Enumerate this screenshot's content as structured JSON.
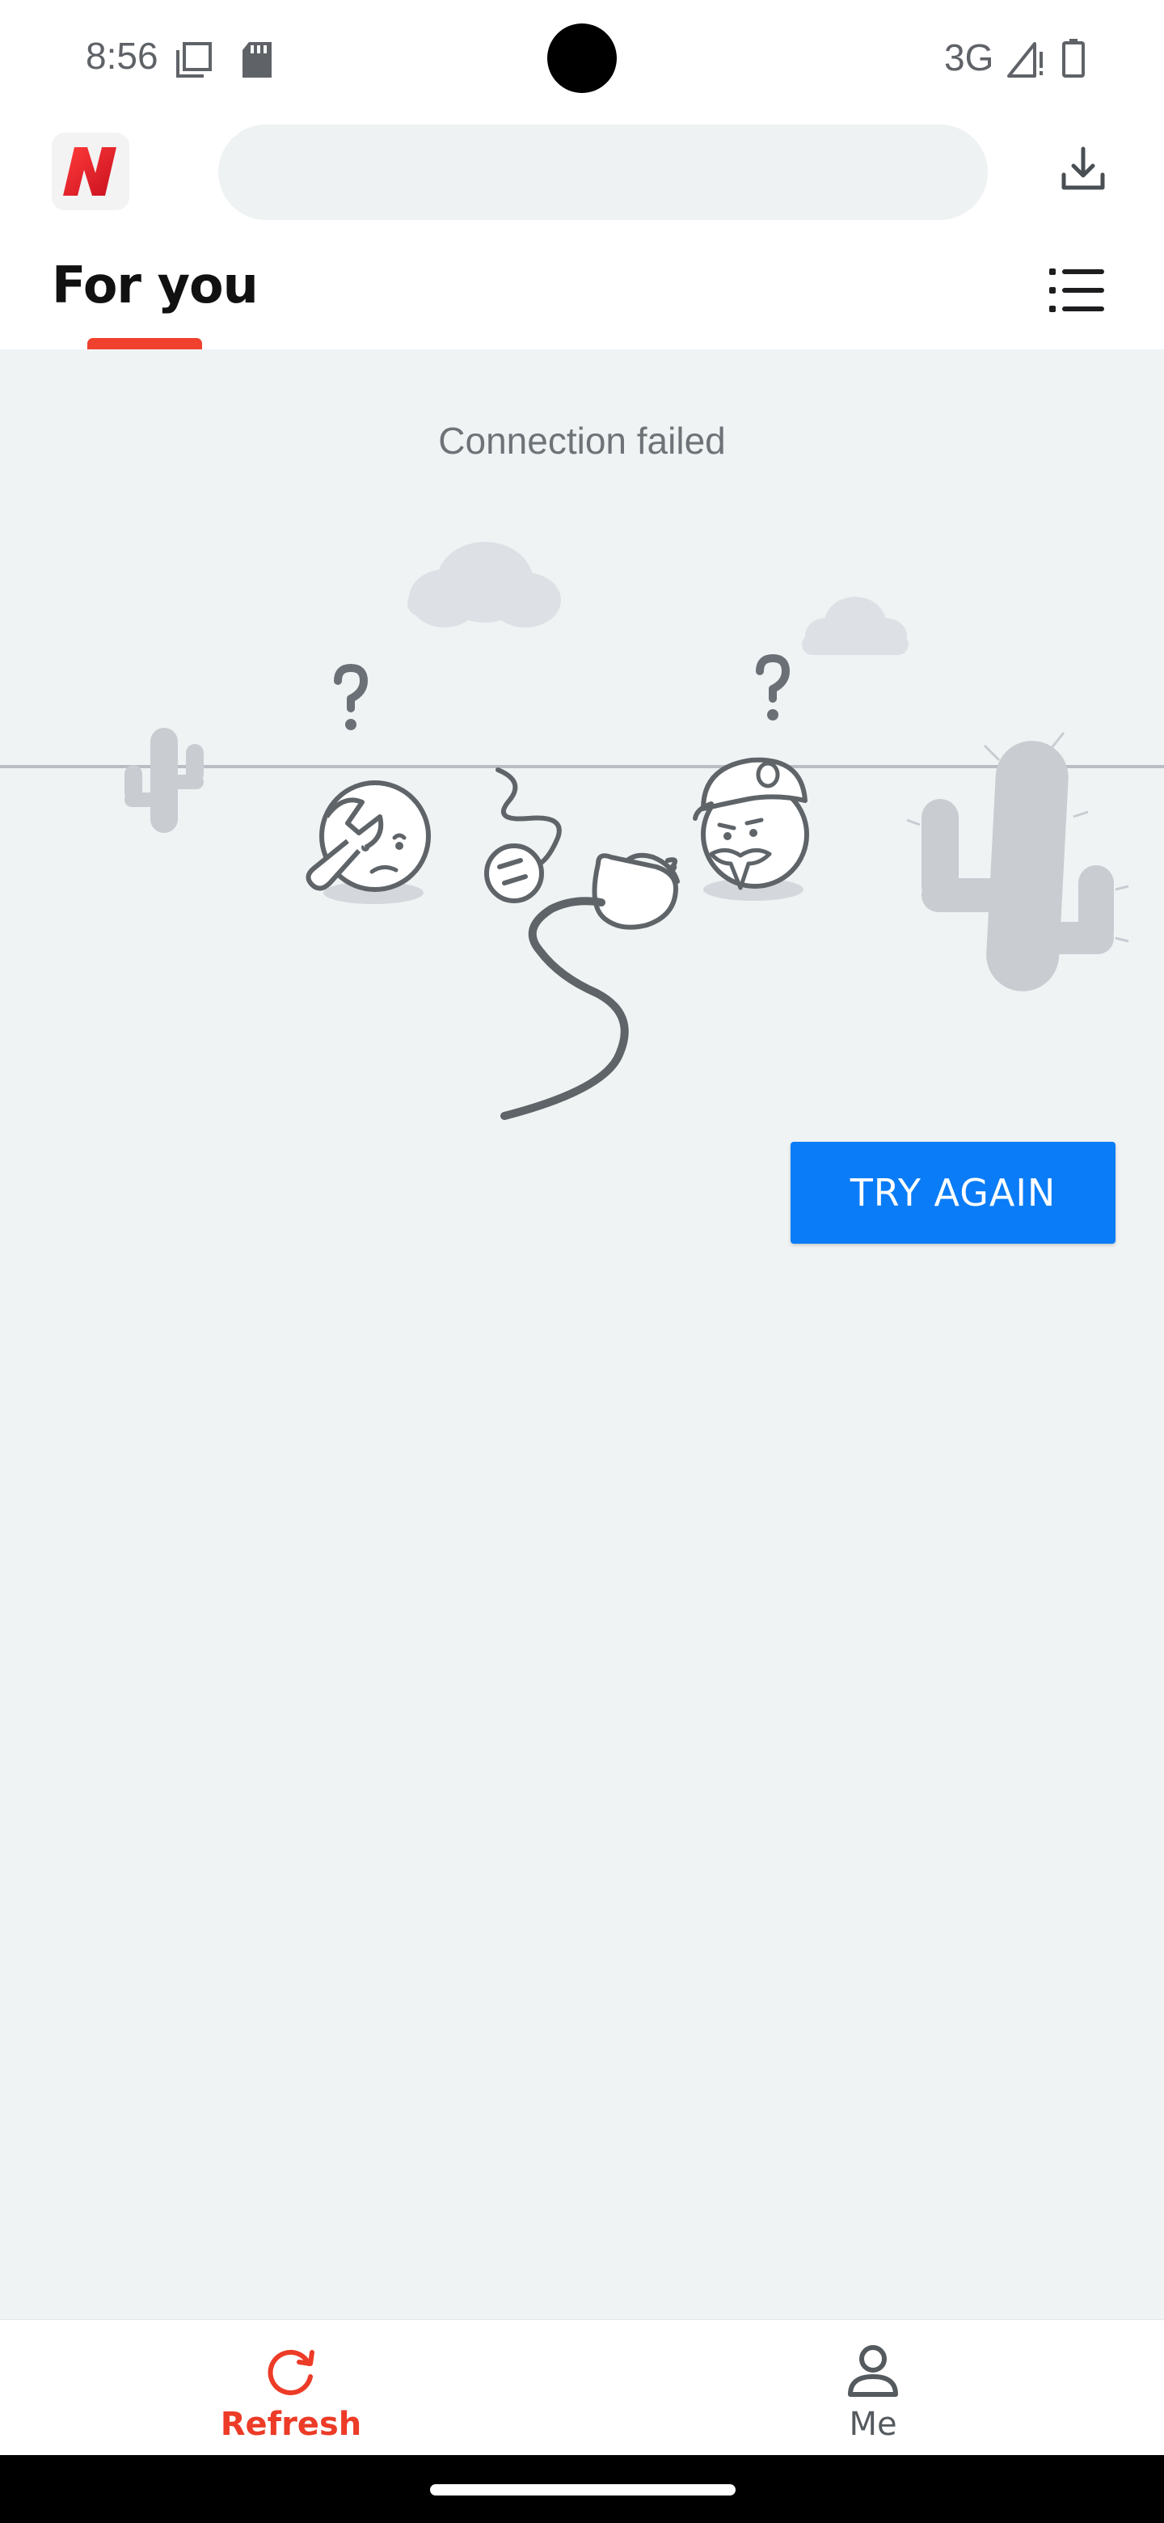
{
  "status_bar": {
    "time": "8:56",
    "network": "3G"
  },
  "top_bar": {
    "logo_letter": "N",
    "search_value": "",
    "download_label": "Downloads"
  },
  "tabs": {
    "active_label": "For you"
  },
  "content": {
    "error_message": "Connection failed",
    "try_again_label": "TRY AGAIN"
  },
  "bottom_nav": {
    "items": [
      {
        "label": "Refresh",
        "icon": "refresh-icon",
        "active": true
      },
      {
        "label": "Me",
        "icon": "person-icon",
        "active": false
      }
    ]
  },
  "colors": {
    "accent_red": "#f0402e",
    "button_blue": "#0a7cf7",
    "content_background": "#eff3f4"
  }
}
